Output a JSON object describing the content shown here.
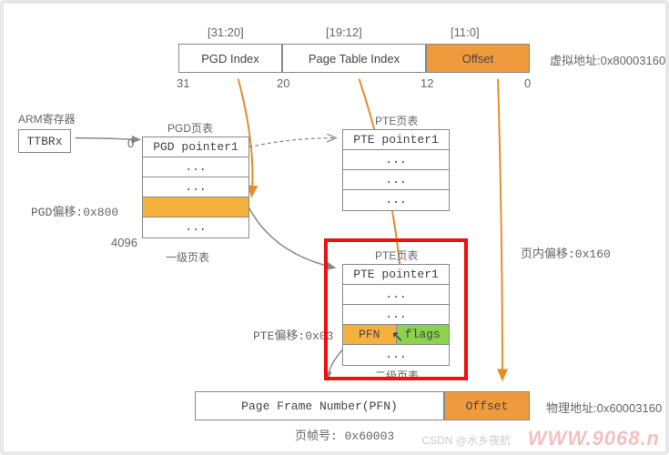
{
  "virtual_address_label": "虚拟地址:0x80003160",
  "bits": {
    "pgd_range": "[31:20]",
    "pte_range": "[19:12]",
    "offset_range": "[11:0]",
    "pgd_name": "PGD Index",
    "pte_name": "Page Table Index",
    "offset_name": "Offset",
    "b31": "31",
    "b20": "20",
    "b12": "12",
    "b0": "0"
  },
  "arm_reg_label": "ARM寄存器",
  "ttbrx": "TTBRx",
  "pgd": {
    "title": "PGD页表",
    "entry0": "PGD pointer1",
    "dots": "...",
    "zero": "0",
    "end": "4096",
    "offset_label": "PGD偏移:0x800",
    "caption": "一级页表"
  },
  "pte_upper": {
    "title": "PTE页表",
    "entry0": "PTE pointer1",
    "dots": "..."
  },
  "pte_lower": {
    "title": "PTE页表",
    "entry0": "PTE pointer1",
    "dots": "...",
    "offset_label": "PTE偏移:0x03",
    "pfn": "PFN",
    "flags": "flags",
    "caption": "二级页表"
  },
  "page_offset_label": "页内偏移:0x160",
  "phys": {
    "pfn_label": "Page Frame Number(PFN)",
    "offset_label": "Offset",
    "address_label": "物理地址:0x60003160",
    "frame_label": "页帧号: 0x60003"
  },
  "watermark": "CSDN @水乡夜航",
  "watermark2": "WWW.9068.n"
}
